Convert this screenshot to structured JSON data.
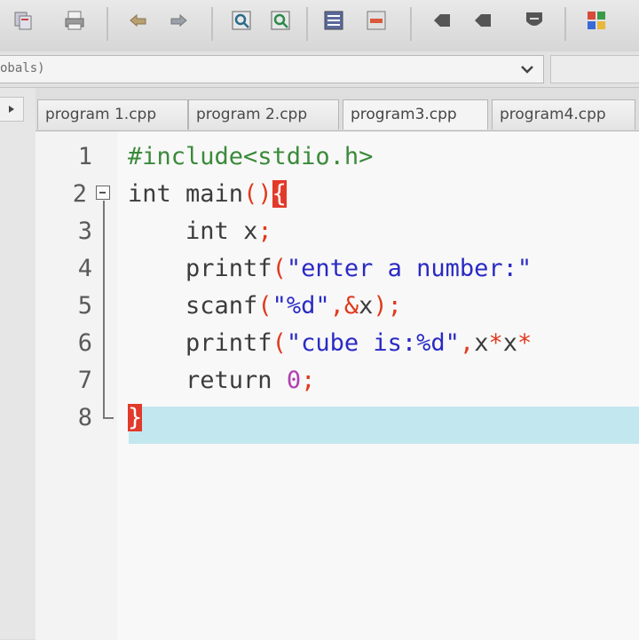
{
  "toolbar": {
    "icons": [
      "copy-icon",
      "print-icon",
      "undo-icon",
      "redo-icon",
      "find-icon",
      "replace-icon",
      "indent-icon",
      "unindent-icon",
      "bookmark-icon",
      "bookmark-prev-icon",
      "shield-icon",
      "grid-icon"
    ]
  },
  "scope": {
    "value": "obals)"
  },
  "tabs": [
    {
      "label": "program 1.cpp"
    },
    {
      "label": "program 2.cpp"
    },
    {
      "label": "program3.cpp"
    },
    {
      "label": "program4.cpp"
    }
  ],
  "editor": {
    "line_numbers": [
      "1",
      "2",
      "3",
      "4",
      "5",
      "6",
      "7",
      "8"
    ],
    "lines": [
      {
        "indent": "",
        "parts": [
          [
            "pp",
            "#include<stdio.h>"
          ]
        ]
      },
      {
        "indent": "",
        "parts": [
          [
            "kw",
            "int"
          ],
          [
            "kw",
            " main"
          ],
          [
            "op",
            "()"
          ],
          [
            "brace",
            "{"
          ]
        ]
      },
      {
        "indent": "    ",
        "parts": [
          [
            "kw",
            "int"
          ],
          [
            "kw",
            " x"
          ],
          [
            "op",
            ";"
          ]
        ]
      },
      {
        "indent": "    ",
        "parts": [
          [
            "kw",
            "printf"
          ],
          [
            "op",
            "("
          ],
          [
            "str",
            "\"enter a number:\""
          ]
        ]
      },
      {
        "indent": "    ",
        "parts": [
          [
            "kw",
            "scanf"
          ],
          [
            "op",
            "("
          ],
          [
            "str",
            "\"%d\""
          ],
          [
            "op",
            ",&"
          ],
          [
            "kw",
            "x"
          ],
          [
            "op",
            ");"
          ]
        ]
      },
      {
        "indent": "    ",
        "parts": [
          [
            "kw",
            "printf"
          ],
          [
            "op",
            "("
          ],
          [
            "str",
            "\"cube is:%d\""
          ],
          [
            "op",
            ","
          ],
          [
            "kw",
            "x"
          ],
          [
            "op",
            "*"
          ],
          [
            "kw",
            "x"
          ],
          [
            "op",
            "*"
          ]
        ]
      },
      {
        "indent": "    ",
        "parts": [
          [
            "kw",
            "return"
          ],
          [
            "kw",
            " "
          ],
          [
            "num",
            "0"
          ],
          [
            "op",
            ";"
          ]
        ]
      },
      {
        "indent": "",
        "parts": [
          [
            "brace",
            "}"
          ]
        ]
      }
    ]
  },
  "colors": {
    "preprocessor": "#3a8a3a",
    "string": "#2a2ac4",
    "operator": "#e03a1e",
    "number": "#b040b0",
    "brace_highlight": "#e23a2a",
    "current_line": "#c2e7ef"
  }
}
